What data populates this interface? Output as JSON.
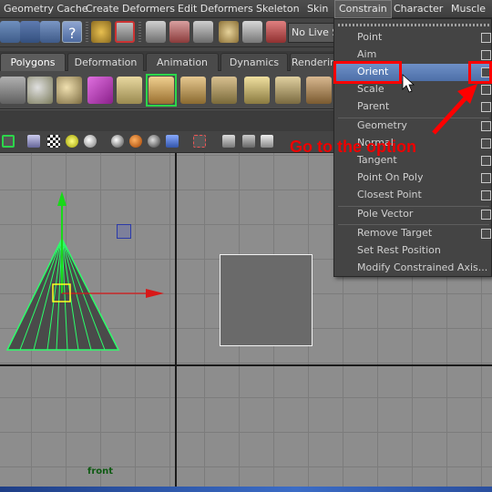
{
  "menubar": {
    "items": [
      "Geometry Cache",
      "Create Deformers",
      "Edit Deformers",
      "Skeleton",
      "Skin",
      "Constrain",
      "Character",
      "Muscle"
    ],
    "active_index": 5
  },
  "statusline": {
    "live_surface": "No Live Surface"
  },
  "shelf_tabs": {
    "items": [
      "Polygons",
      "Deformation",
      "Animation",
      "Dynamics",
      "Rendering"
    ],
    "active_index": 0
  },
  "viewport": {
    "camera_label": "front"
  },
  "constrain_menu": {
    "items": [
      {
        "label": "Point",
        "option_box": true
      },
      {
        "label": "Aim",
        "option_box": true
      },
      {
        "label": "Orient",
        "option_box": true,
        "highlighted": true
      },
      {
        "label": "Scale",
        "option_box": true
      },
      {
        "label": "Parent",
        "option_box": true
      },
      {
        "label": "Geometry",
        "option_box": true
      },
      {
        "label": "Normal",
        "option_box": true
      },
      {
        "label": "Tangent",
        "option_box": true
      },
      {
        "label": "Point On Poly",
        "option_box": true
      },
      {
        "label": "Closest Point",
        "option_box": true
      },
      {
        "label": "Pole Vector",
        "option_box": true
      },
      {
        "label": "Remove Target",
        "option_box": true
      },
      {
        "label": "Set Rest Position",
        "option_box": false
      },
      {
        "label": "Modify Constrained Axis...",
        "option_box": false
      }
    ]
  },
  "annotation": {
    "text": "Go to the option",
    "color": "#ff0000"
  },
  "colors": {
    "menu_highlight": "#5b7db8",
    "selection_green": "#2cd64a",
    "annotation_red": "#ff0000"
  }
}
